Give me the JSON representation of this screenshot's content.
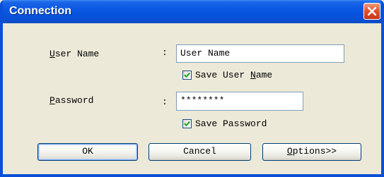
{
  "window": {
    "title": "Connection"
  },
  "form": {
    "username": {
      "label_hotkey": "U",
      "label_rest": "ser Name",
      "colon": ":",
      "value": "User Name"
    },
    "save_username": {
      "checked": true,
      "label_before": "Save User ",
      "label_hotkey": "N",
      "label_after": "ame"
    },
    "password": {
      "label_hotkey": "P",
      "label_rest": "assword",
      "colon": ":",
      "value": "********"
    },
    "save_password": {
      "checked": true,
      "label": "Save Password"
    }
  },
  "buttons": {
    "ok": "OK",
    "cancel": "Cancel",
    "options_hotkey": "O",
    "options_rest": "ptions>>"
  },
  "icons": {
    "close": "close-icon",
    "check": "checkmark-icon"
  },
  "colors": {
    "titlebar": "#0a58e2",
    "close_button": "#e2532d",
    "dialog_background": "#ece9d8",
    "checkmark": "#21a121"
  }
}
